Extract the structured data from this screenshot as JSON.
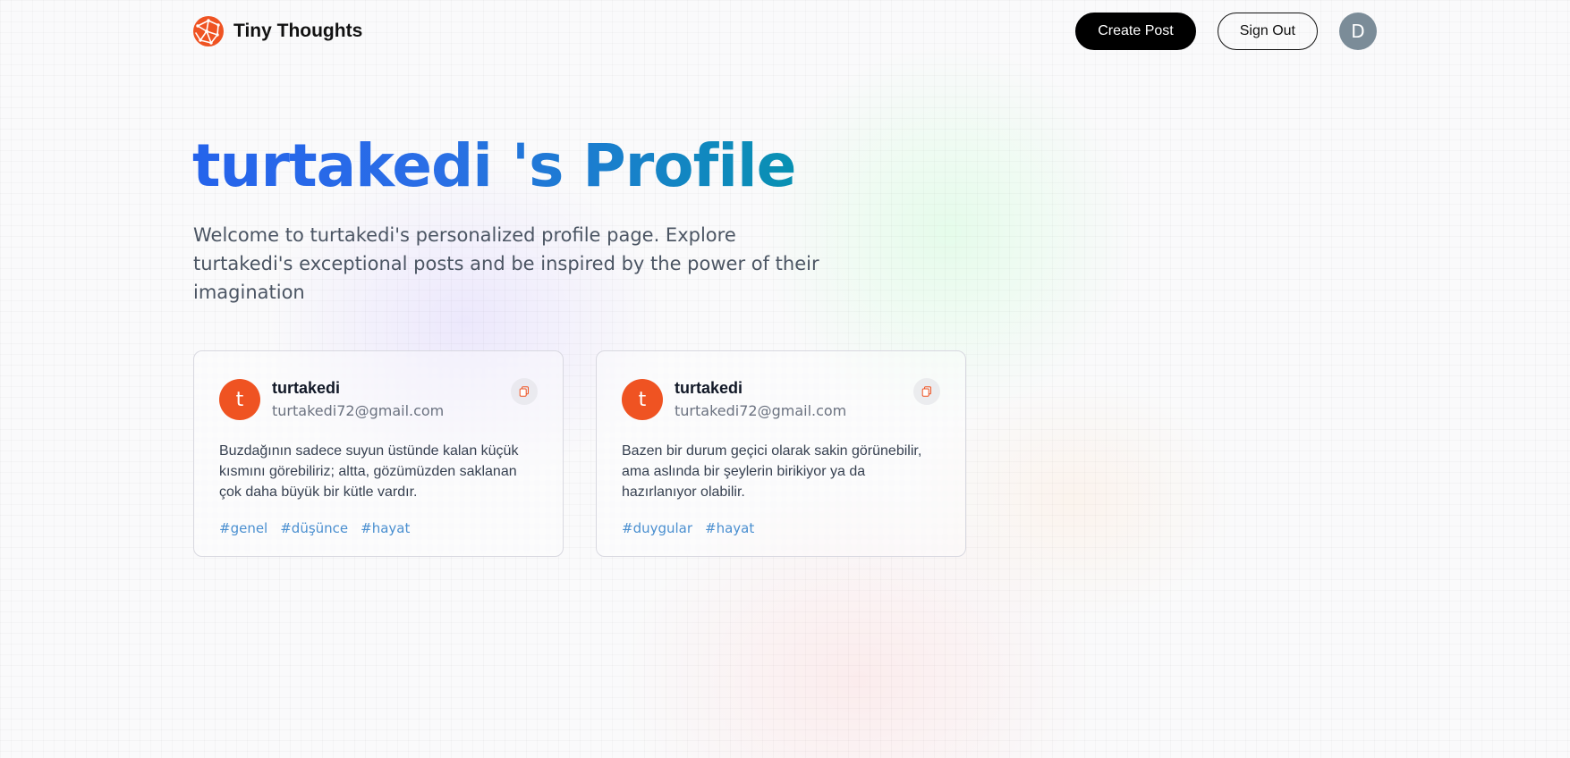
{
  "nav": {
    "brand_name": "Tiny Thoughts",
    "create_post_label": "Create Post",
    "sign_out_label": "Sign Out",
    "avatar_initial": "D",
    "logo_icon": "globe-network-icon"
  },
  "profile": {
    "title": "turtakedi 's Profile",
    "description": "Welcome to turtakedi's personalized profile page. Explore turtakedi's exceptional posts and be inspired by the power of their imagination"
  },
  "posts": [
    {
      "avatar_initial": "t",
      "username": "turtakedi",
      "email": "turtakedi72@gmail.com",
      "content": "Buzdağının sadece suyun üstünde kalan küçük kısmını görebiliriz; altta, gözümüzden saklanan çok daha büyük bir kütle vardır.",
      "tags": [
        "#genel",
        "#düşünce",
        "#hayat"
      ]
    },
    {
      "avatar_initial": "t",
      "username": "turtakedi",
      "email": "turtakedi72@gmail.com",
      "content": "Bazen bir durum geçici olarak sakin görünebilir, ama aslında bir şeylerin birikiyor ya da hazırlanıyor olabilir.",
      "tags": [
        "#duygular",
        "#hayat"
      ]
    }
  ],
  "colors": {
    "accent_orange": "#ef5322",
    "title_gradient_start": "#2563eb",
    "title_gradient_end": "#0891b2",
    "tag_blue": "#4a8fd0"
  }
}
